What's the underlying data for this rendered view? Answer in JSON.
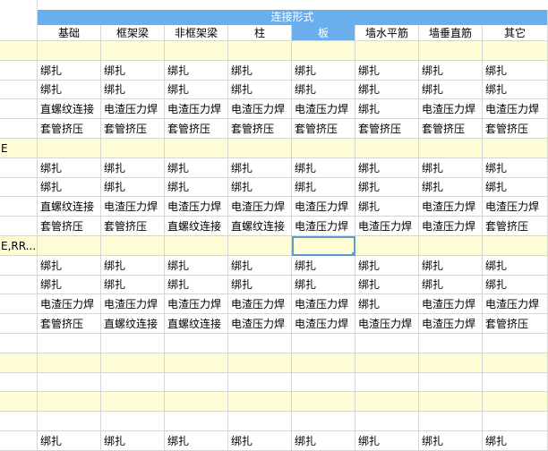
{
  "header": {
    "group_label": "连接形式",
    "columns": [
      "基础",
      "框架梁",
      "非框架梁",
      "柱",
      "板",
      "墙水平筋",
      "墙垂直筋",
      "其它"
    ],
    "selected_column_index": 4
  },
  "rows": [
    {
      "type": "group",
      "label": ""
    },
    {
      "type": "data",
      "label": "",
      "cells": [
        "绑扎",
        "绑扎",
        "绑扎",
        "绑扎",
        "绑扎",
        "绑扎",
        "绑扎",
        "绑扎"
      ]
    },
    {
      "type": "data",
      "label": "",
      "cells": [
        "绑扎",
        "绑扎",
        "绑扎",
        "绑扎",
        "绑扎",
        "绑扎",
        "绑扎",
        "绑扎"
      ]
    },
    {
      "type": "data",
      "label": "",
      "cells": [
        "直螺纹连接",
        "电渣压力焊",
        "电渣压力焊",
        "电渣压力焊",
        "电渣压力焊",
        "绑扎",
        "电渣压力焊",
        "电渣压力焊"
      ]
    },
    {
      "type": "data",
      "label": "",
      "cells": [
        "套管挤压",
        "套管挤压",
        "套管挤压",
        "套管挤压",
        "套管挤压",
        "套管挤压",
        "套管挤压",
        "套管挤压"
      ]
    },
    {
      "type": "group",
      "label": "E"
    },
    {
      "type": "data",
      "label": "",
      "cells": [
        "绑扎",
        "绑扎",
        "绑扎",
        "绑扎",
        "绑扎",
        "绑扎",
        "绑扎",
        "绑扎"
      ]
    },
    {
      "type": "data",
      "label": "",
      "cells": [
        "绑扎",
        "绑扎",
        "绑扎",
        "绑扎",
        "绑扎",
        "绑扎",
        "绑扎",
        "绑扎"
      ]
    },
    {
      "type": "data",
      "label": "",
      "cells": [
        "直螺纹连接",
        "电渣压力焊",
        "电渣压力焊",
        "电渣压力焊",
        "电渣压力焊",
        "绑扎",
        "电渣压力焊",
        "电渣压力焊"
      ]
    },
    {
      "type": "data",
      "label": "",
      "cells": [
        "套管挤压",
        "套管挤压",
        "直螺纹连接",
        "直螺纹连接",
        "电渣压力焊",
        "电渣压力焊",
        "电渣压力焊",
        "套管挤压"
      ]
    },
    {
      "type": "group",
      "label": "E,RR...",
      "selected_cell_index": 4
    },
    {
      "type": "data",
      "label": "",
      "cells": [
        "绑扎",
        "绑扎",
        "绑扎",
        "绑扎",
        "绑扎",
        "绑扎",
        "绑扎",
        "绑扎"
      ]
    },
    {
      "type": "data",
      "label": "",
      "cells": [
        "绑扎",
        "绑扎",
        "绑扎",
        "绑扎",
        "绑扎",
        "绑扎",
        "绑扎",
        "绑扎"
      ]
    },
    {
      "type": "data",
      "label": "",
      "cells": [
        "电渣压力焊",
        "电渣压力焊",
        "电渣压力焊",
        "电渣压力焊",
        "电渣压力焊",
        "绑扎",
        "电渣压力焊",
        "电渣压力焊"
      ]
    },
    {
      "type": "data",
      "label": "",
      "cells": [
        "套管挤压",
        "直螺纹连接",
        "直螺纹连接",
        "电渣压力焊",
        "电渣压力焊",
        "电渣压力焊",
        "电渣压力焊",
        "套管挤压"
      ]
    },
    {
      "type": "data",
      "label": "",
      "cells": [
        "",
        "",
        "",
        "",
        "",
        "",
        "",
        ""
      ]
    },
    {
      "type": "group",
      "label": ""
    },
    {
      "type": "data",
      "label": "",
      "cells": [
        "",
        "",
        "",
        "",
        "",
        "",
        "",
        ""
      ]
    },
    {
      "type": "group",
      "label": ""
    },
    {
      "type": "data",
      "label": "",
      "cells": [
        "",
        "",
        "",
        "",
        "",
        "",
        "",
        ""
      ]
    },
    {
      "type": "data",
      "label": "",
      "cells": [
        "绑扎",
        "绑扎",
        "绑扎",
        "绑扎",
        "绑扎",
        "绑扎",
        "绑扎",
        "绑扎"
      ]
    }
  ],
  "colors": {
    "header_blue": "#6aaeee",
    "group_row_yellow": "#fffdd5",
    "grid_line": "#d6d6d6",
    "selection_blue": "#5b9bd5"
  }
}
